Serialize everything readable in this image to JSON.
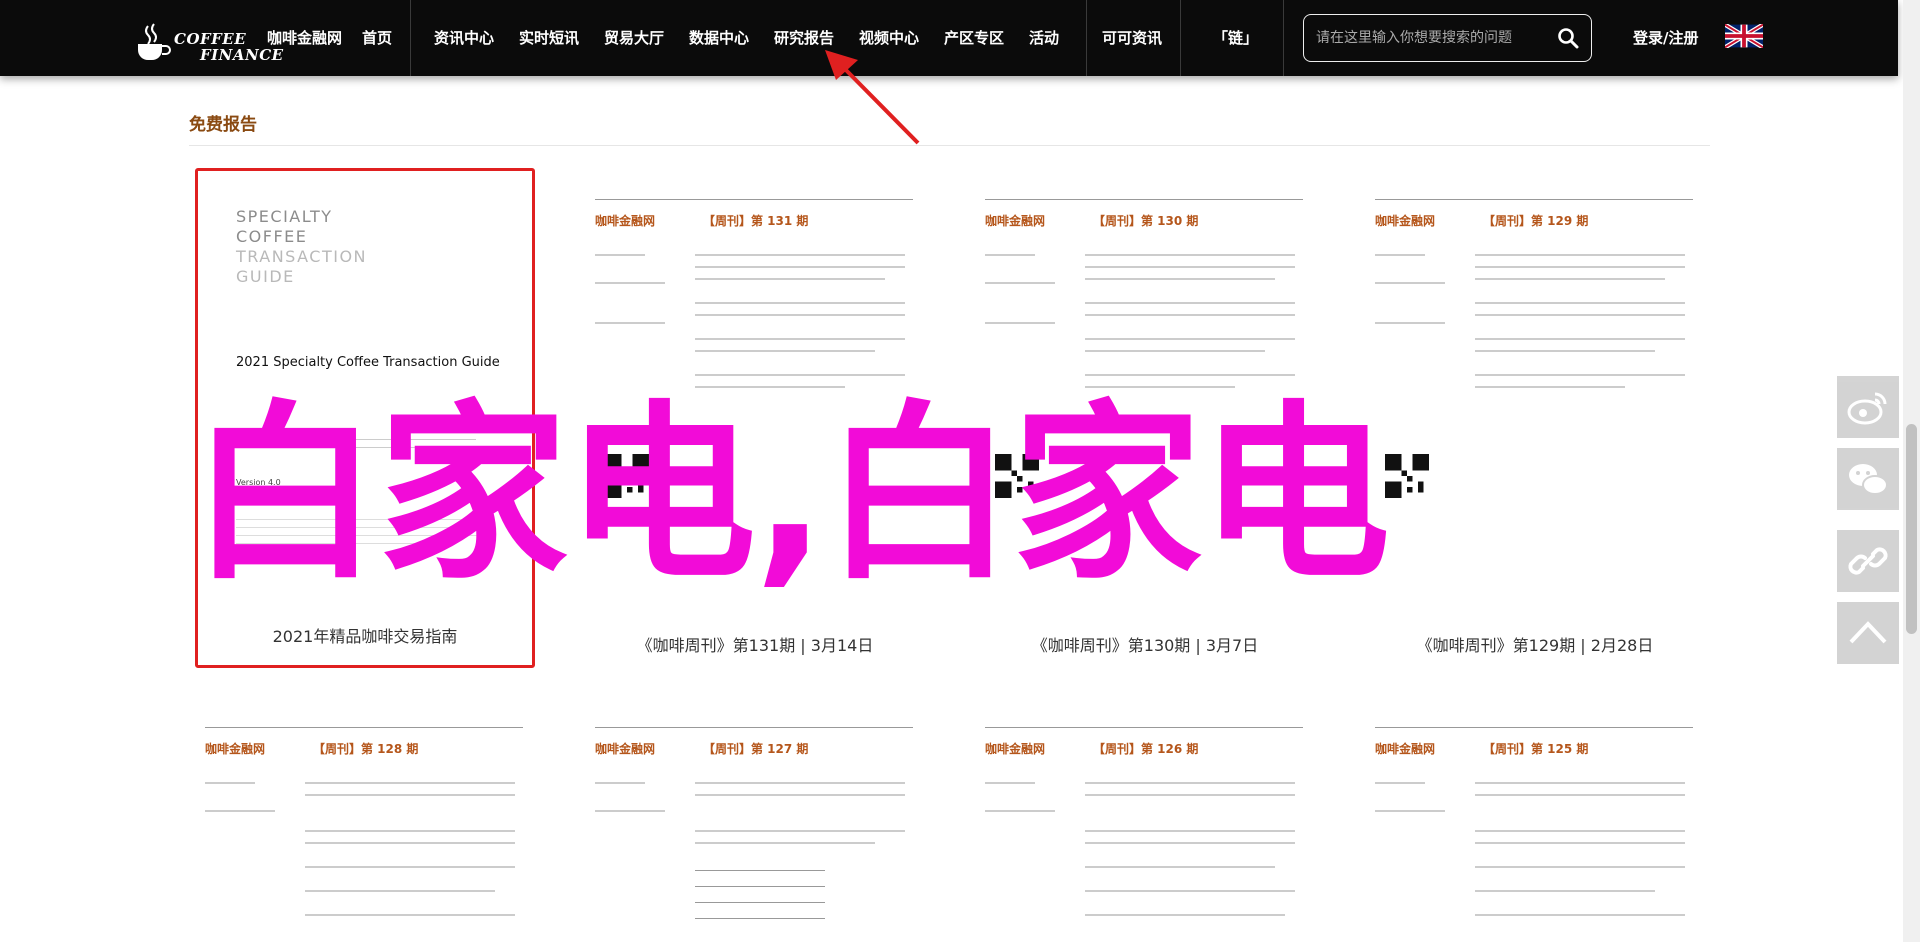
{
  "nav": {
    "logo_line1": "COFFEE",
    "logo_line2": "FINANCE",
    "items": [
      {
        "label": "咖啡金融网"
      },
      {
        "label": "首页"
      },
      {
        "label": "资讯中心"
      },
      {
        "label": "实时短讯"
      },
      {
        "label": "贸易大厅"
      },
      {
        "label": "数据中心"
      },
      {
        "label": "研究报告"
      },
      {
        "label": "视频中心"
      },
      {
        "label": "产区专区"
      },
      {
        "label": "活动"
      },
      {
        "label": "可可资讯"
      },
      {
        "label": "「链」"
      }
    ],
    "search_placeholder": "请在这里输入你想要搜索的问题",
    "login_label": "登录/注册"
  },
  "section": {
    "title": "免费报告"
  },
  "cards_row1": [
    {
      "caption": "2021年精品咖啡交易指南"
    },
    {
      "caption": "《咖啡周刊》第131期 | 3月14日",
      "issue": "【周刊】第 131 期"
    },
    {
      "caption": "《咖啡周刊》第130期 | 3月7日",
      "issue": "【周刊】第 130 期"
    },
    {
      "caption": "《咖啡周刊》第129期 | 2月28日",
      "issue": "【周刊】第 129 期"
    }
  ],
  "cards_row2": [
    {
      "issue": "【周刊】第 128 期"
    },
    {
      "issue": "【周刊】第 127 期"
    },
    {
      "issue": "【周刊】第 126 期"
    },
    {
      "issue": "【周刊】第 125 期"
    }
  ],
  "weekly_brand": "咖啡金融网",
  "guide_cover": {
    "line1": "SPECIALTY",
    "line2": "COFFEE",
    "line3": "TRANSACTION",
    "line4": "GUIDE",
    "title": "2021 Specialty Coffee Transaction Guide",
    "version": "Version 4.0",
    "released": "Released January 2022"
  },
  "watermark": "白家电,白家电",
  "colors": {
    "nav_bg": "#0b0b0b",
    "accent_brown": "#8a4a12",
    "watermark": "#f20bd8",
    "highlight_border": "#e02020"
  }
}
